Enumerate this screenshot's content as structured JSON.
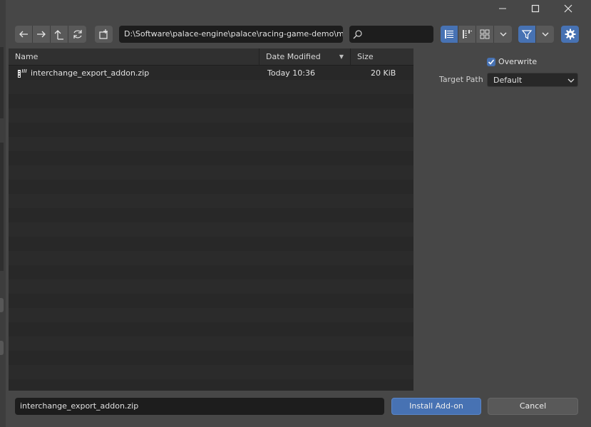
{
  "window": {
    "minimize_icon": "minimize-icon",
    "maximize_icon": "maximize-icon",
    "close_icon": "close-icon"
  },
  "toolbar": {
    "nav_icons": [
      "arrow-left-icon",
      "arrow-right-icon",
      "parent-folder-icon",
      "refresh-icon"
    ],
    "new_folder_icon": "new-folder-icon",
    "path": "D:\\Software\\palace-engine\\palace\\racing-game-demo\\modd...",
    "search_placeholder": "",
    "display_modes": [
      "vertical-list-icon",
      "horizontal-list-icon",
      "thumbnails-icon"
    ],
    "filter_icon": "filter-icon",
    "settings_icon": "gear-icon"
  },
  "file_list": {
    "columns": [
      {
        "label": "Name"
      },
      {
        "label": "Date Modified"
      },
      {
        "label": "Size"
      }
    ],
    "sort_indicator": "▼",
    "rows": [
      {
        "name": "interchange_export_addon.zip",
        "date": "Today 10:36",
        "size": "20 KiB",
        "icon": "zip-file-icon"
      }
    ]
  },
  "options": {
    "overwrite_label": "Overwrite",
    "overwrite_checked": true,
    "target_path_label": "Target Path",
    "target_path_value": "Default"
  },
  "footer": {
    "filename": "interchange_export_addon.zip",
    "install_label": "Install Add-on",
    "cancel_label": "Cancel"
  },
  "colors": {
    "accent": "#4772b3",
    "background": "#474747",
    "list_bg": "#282828"
  }
}
